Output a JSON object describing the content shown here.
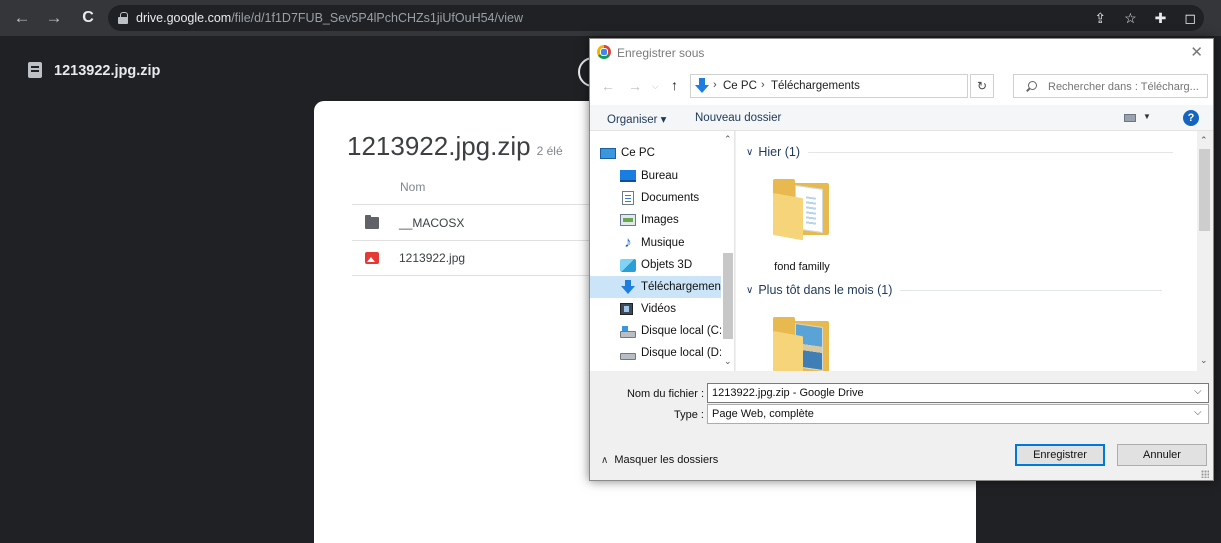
{
  "browser": {
    "url_host": "drive.google.com",
    "url_path": "/file/d/1f1D7FUB_Sev5P4lPchCHZs1jiUfOuH54/view"
  },
  "drive": {
    "file_title": "1213922.jpg.zip",
    "zip_title": "1213922.jpg.zip",
    "zip_count": "2 élé",
    "column_name": "Nom",
    "rows": [
      {
        "name": "__MACOSX"
      },
      {
        "name": "1213922.jpg"
      }
    ]
  },
  "dialog": {
    "title": "Enregistrer sous",
    "breadcrumb": [
      "Ce PC",
      "Téléchargements"
    ],
    "search_placeholder": "Rechercher dans : Télécharg...",
    "organize_label": "Organiser ▾",
    "new_folder_label": "Nouveau dossier",
    "nav_items": [
      {
        "label": "Ce PC",
        "icon": "pc-icon"
      },
      {
        "label": "Bureau",
        "icon": "desktop-icon"
      },
      {
        "label": "Documents",
        "icon": "documents-icon"
      },
      {
        "label": "Images",
        "icon": "pictures-icon"
      },
      {
        "label": "Musique",
        "icon": "music-icon"
      },
      {
        "label": "Objets 3D",
        "icon": "3d-objects-icon"
      },
      {
        "label": "Téléchargements",
        "icon": "download-icon"
      },
      {
        "label": "Vidéos",
        "icon": "videos-icon"
      },
      {
        "label": "Disque local (C:)",
        "icon": "drive-c-icon"
      },
      {
        "label": "Disque local (D:)",
        "icon": "drive-d-icon"
      }
    ],
    "selected_nav": "Téléchargements",
    "groups": [
      {
        "label": "Hier (1)",
        "items": [
          "fond familly"
        ]
      },
      {
        "label": "Plus tôt dans le mois (1)",
        "items": [
          ""
        ]
      }
    ],
    "filename_label": "Nom du fichier :",
    "filename_value": "1213922.jpg.zip - Google Drive",
    "type_label": "Type :",
    "type_value": "Page Web, complète",
    "hide_folders_label": "Masquer les dossiers",
    "save_button": "Enregistrer",
    "cancel_button": "Annuler",
    "accent_color": "#0078d7",
    "selection_color": "#cce4f7"
  }
}
